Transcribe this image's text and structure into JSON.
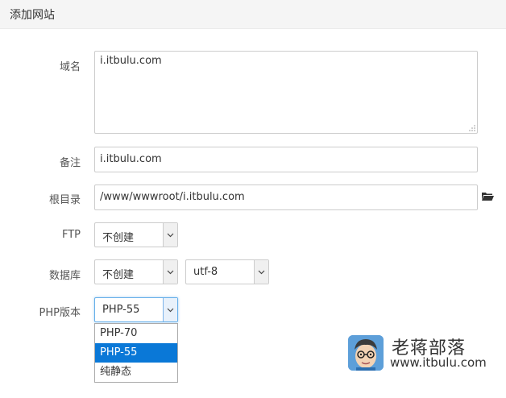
{
  "dialog": {
    "title": "添加网站"
  },
  "form": {
    "domain": {
      "label": "域名",
      "value": "i.itbulu.com"
    },
    "note": {
      "label": "备注",
      "value": "i.itbulu.com"
    },
    "root_dir": {
      "label": "根目录",
      "value": "/www/wwwroot/i.itbulu.com",
      "icon": "folder-open-icon"
    },
    "ftp": {
      "label": "FTP",
      "selected": "不创建"
    },
    "database": {
      "label": "数据库",
      "selected": "不创建",
      "charset": "utf-8"
    },
    "php_version": {
      "label": "PHP版本",
      "selected": "PHP-55",
      "options": [
        "PHP-70",
        "PHP-55",
        "纯静态"
      ],
      "highlighted_index": 1
    }
  },
  "watermark": {
    "name": "老蒋部落",
    "url": "www.itbulu.com"
  },
  "colors": {
    "accent": "#0a78d7",
    "header_bg": "#f5f5f5",
    "focus": "#66afe9"
  }
}
